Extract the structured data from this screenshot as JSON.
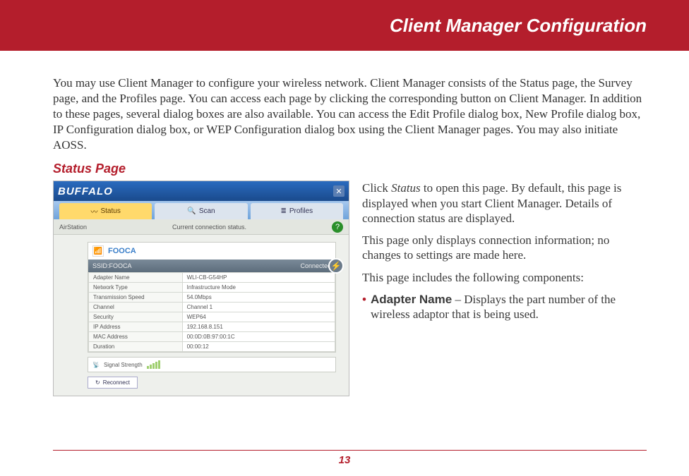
{
  "header": {
    "title": "Client Manager Configuration"
  },
  "intro": "You may use Client Manager to configure your wireless network. Client Manager consists of the Status page, the Survey page, and the Profiles page. You can access each page by clicking the corresponding button on Client Manager. In addition to these pages, several dialog boxes are also available. You can access the Edit Profile dialog box, New Profile dialog box, IP Configuration dialog box, or WEP Configuration dialog box using the Client Manager pages.  You may also initiate AOSS.",
  "section": {
    "title": "Status Page"
  },
  "status_text": {
    "p1_a": "Click ",
    "p1_em": "Status",
    "p1_b": " to open this page. By default, this page is displayed when you start Client Manager. Details of connection status are displayed.",
    "p2": "This page only displays connection information; no changes to settings are made here.",
    "p3": "This page includes the following components:",
    "bullet_label": "Adapter Name",
    "bullet_text": " – Displays the part number of the wireless adaptor that is being used."
  },
  "app": {
    "brand": "BUFFALO",
    "tabs": {
      "status": "Status",
      "scan": "Scan",
      "profiles": "Profiles"
    },
    "subbar_left": "AirStation",
    "subbar_center": "Current connection status.",
    "help": "?",
    "ssid_name": "FOOCA",
    "ssid_label": "SSID:FOOCA",
    "connected": "Connected",
    "rows": [
      [
        "Adapter Name",
        "WLI-CB-G54HP"
      ],
      [
        "Network Type",
        "Infrastructure Mode"
      ],
      [
        "Transmission Speed",
        "54.0Mbps"
      ],
      [
        "Channel",
        "Channel 1"
      ],
      [
        "Security",
        "WEP64"
      ],
      [
        "IP Address",
        "192.168.8.151"
      ],
      [
        "MAC Address",
        "00:0D:0B:97:00:1C"
      ],
      [
        "Duration",
        "00:00:12"
      ]
    ],
    "signal_label": "Signal Strength",
    "reconnect": "Reconnect"
  },
  "page_number": "13"
}
